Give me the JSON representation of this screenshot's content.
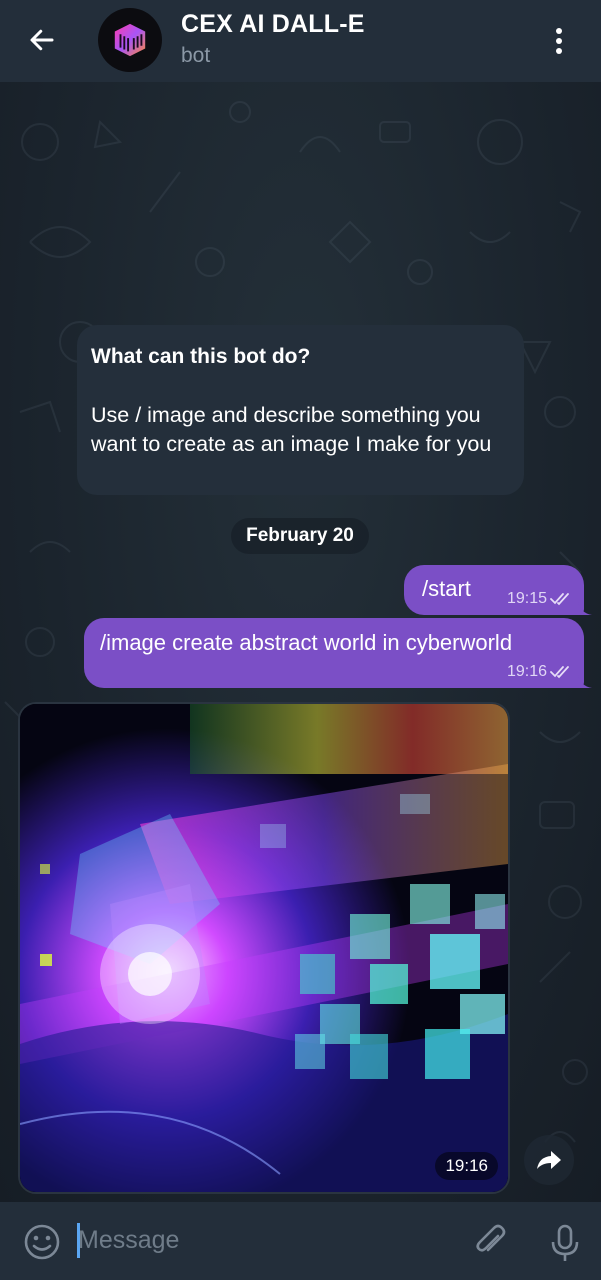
{
  "header": {
    "back_icon": "arrow-left-icon",
    "title": "CEX AI DALL-E",
    "subtitle": "bot",
    "menu_icon": "more-vertical-icon"
  },
  "bot_info": {
    "title": "What can this bot do?",
    "body": "Use / image and describe something you want to create as an image I make for you"
  },
  "date_separator": "February 20",
  "messages": [
    {
      "text": "/start",
      "time": "19:15",
      "status_icon": "double-check-icon"
    },
    {
      "text": "/image create abstract world in cyberworld",
      "time": "19:16",
      "status_icon": "double-check-icon"
    }
  ],
  "image_message": {
    "time": "19:16",
    "share_icon": "share-icon"
  },
  "input": {
    "placeholder": "Message",
    "value": "",
    "emoji_icon": "emoji-icon",
    "attach_icon": "paperclip-icon",
    "mic_icon": "microphone-icon"
  },
  "colors": {
    "header_bg": "#232e3a",
    "chat_bg": "#1b242d",
    "outgoing_bubble": "#7b4fc6",
    "incoming_bubble": "#242f3b",
    "accent": "#5ba6f2"
  }
}
